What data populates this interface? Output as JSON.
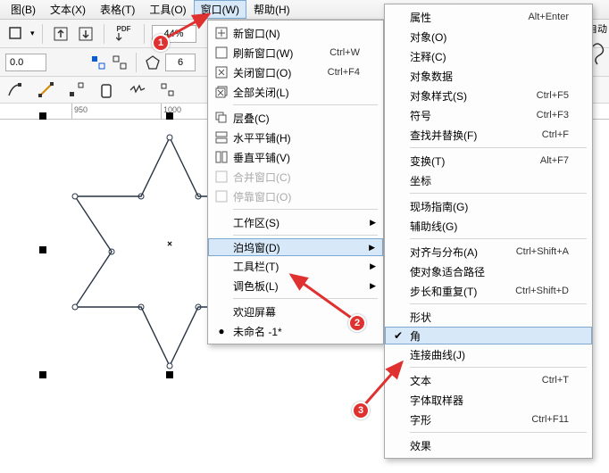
{
  "menubar": {
    "items": [
      "图(B)",
      "文本(X)",
      "表格(T)",
      "工具(O)",
      "窗口(W)",
      "帮助(H)"
    ],
    "active_index": 4
  },
  "toolbar1": {
    "pdf_label_top": "PDF",
    "zoom_value": "44%"
  },
  "toolbar2": {
    "coord_value": "0.0",
    "sides_value": "6"
  },
  "ruler": {
    "labels": [
      "950",
      "1000"
    ]
  },
  "window_menu": {
    "items": [
      {
        "label": "新窗口(N)",
        "shortcut": "",
        "icon": "new-window"
      },
      {
        "label": "刷新窗口(W)",
        "shortcut": "Ctrl+W",
        "icon": "refresh"
      },
      {
        "label": "关闭窗口(O)",
        "shortcut": "Ctrl+F4",
        "icon": "close"
      },
      {
        "label": "全部关闭(L)",
        "shortcut": "",
        "icon": "closeall"
      }
    ],
    "items2": [
      {
        "label": "层叠(C)",
        "icon": "cascade"
      },
      {
        "label": "水平平铺(H)",
        "icon": "tile-h"
      },
      {
        "label": "垂直平铺(V)",
        "icon": "tile-v"
      },
      {
        "label": "合并窗口(C)",
        "icon": "merge",
        "disabled": true
      },
      {
        "label": "停靠窗口(O)",
        "icon": "dock",
        "disabled": true
      }
    ],
    "items3": [
      {
        "label": "工作区(S)",
        "sub": true
      }
    ],
    "items4": [
      {
        "label": "泊坞窗(D)",
        "sub": true,
        "highlight": true
      },
      {
        "label": "工具栏(T)",
        "sub": true
      },
      {
        "label": "调色板(L)",
        "sub": true
      }
    ],
    "items5": [
      {
        "label": "欢迎屏幕"
      },
      {
        "label": "未命名 -1*",
        "icon": "bullet"
      }
    ]
  },
  "dock_menu": {
    "items": [
      {
        "label": "属性",
        "shortcut": "Alt+Enter"
      },
      {
        "label": "对象(O)"
      },
      {
        "label": "注释(C)"
      },
      {
        "label": "对象数据"
      },
      {
        "label": "对象样式(S)",
        "shortcut": "Ctrl+F5"
      },
      {
        "label": "符号",
        "shortcut": "Ctrl+F3"
      },
      {
        "label": "查找并替换(F)",
        "shortcut": "Ctrl+F"
      }
    ],
    "items2": [
      {
        "label": "变换(T)",
        "shortcut": "Alt+F7"
      },
      {
        "label": "坐标"
      }
    ],
    "items3": [
      {
        "label": "现场指南(G)"
      },
      {
        "label": "辅助线(G)"
      }
    ],
    "items4": [
      {
        "label": "对齐与分布(A)",
        "shortcut": "Ctrl+Shift+A"
      },
      {
        "label": "使对象适合路径"
      },
      {
        "label": "步长和重复(T)",
        "shortcut": "Ctrl+Shift+D"
      }
    ],
    "items5": [
      {
        "label": "形状"
      },
      {
        "label": "角",
        "highlight": true,
        "check": true
      },
      {
        "label": "连接曲线(J)"
      }
    ],
    "items6": [
      {
        "label": "文本",
        "shortcut": "Ctrl+T"
      },
      {
        "label": "字体取样器"
      },
      {
        "label": "字形",
        "shortcut": "Ctrl+F11"
      }
    ],
    "items7": [
      {
        "label": "效果"
      }
    ]
  },
  "right_col": {
    "auto_label": "自动"
  },
  "annotations": {
    "b1": "1",
    "b2": "2",
    "b3": "3"
  }
}
